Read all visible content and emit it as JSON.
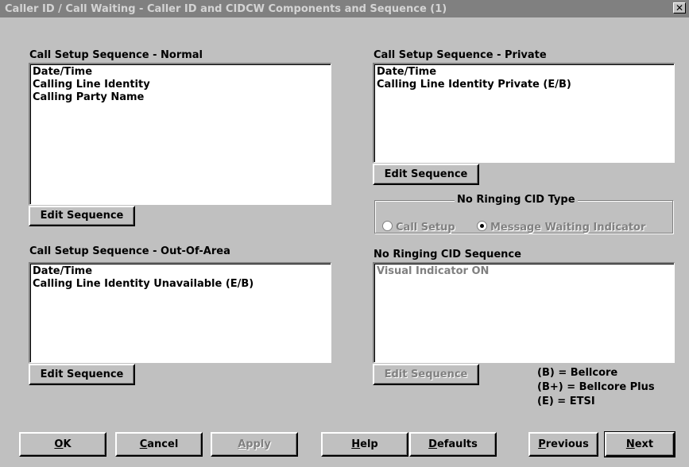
{
  "window": {
    "title": "Caller ID / Call Waiting - Caller ID and CIDCW Components and Sequence (1)",
    "close": "✕"
  },
  "normal": {
    "label": "Call Setup Sequence - Normal",
    "items": [
      "Date/Time",
      "Calling Line Identity",
      "Calling Party Name"
    ],
    "button": "Edit Sequence"
  },
  "private": {
    "label": "Call Setup Sequence - Private",
    "items": [
      "Date/Time",
      "Calling Line Identity Private (E/B)"
    ],
    "button": "Edit Sequence"
  },
  "out_of_area": {
    "label": "Call Setup Sequence - Out-Of-Area",
    "items": [
      "Date/Time",
      "Calling Line Identity Unavailable (E/B)"
    ],
    "button": "Edit Sequence"
  },
  "no_ringing_type": {
    "label": "No Ringing CID Type",
    "options": [
      "Call Setup",
      "Message Waiting Indicator"
    ],
    "selected": "Message Waiting Indicator"
  },
  "no_ringing_sequence": {
    "label": "No Ringing CID Sequence",
    "items": [
      "Visual Indicator ON"
    ],
    "button": "Edit Sequence"
  },
  "legend": [
    "(B) = Bellcore",
    "(B+) = Bellcore Plus",
    "(E) = ETSI"
  ],
  "footer": {
    "ok": {
      "accel": "O",
      "rest": "K"
    },
    "cancel": {
      "accel": "C",
      "rest": "ancel"
    },
    "apply": {
      "accel": "A",
      "rest": "pply"
    },
    "help": {
      "accel": "H",
      "rest": "elp"
    },
    "defaults": {
      "accel": "D",
      "rest": "efaults"
    },
    "previous": {
      "accel": "P",
      "rest": "revious"
    },
    "next": {
      "accel": "N",
      "rest": "ext"
    }
  }
}
